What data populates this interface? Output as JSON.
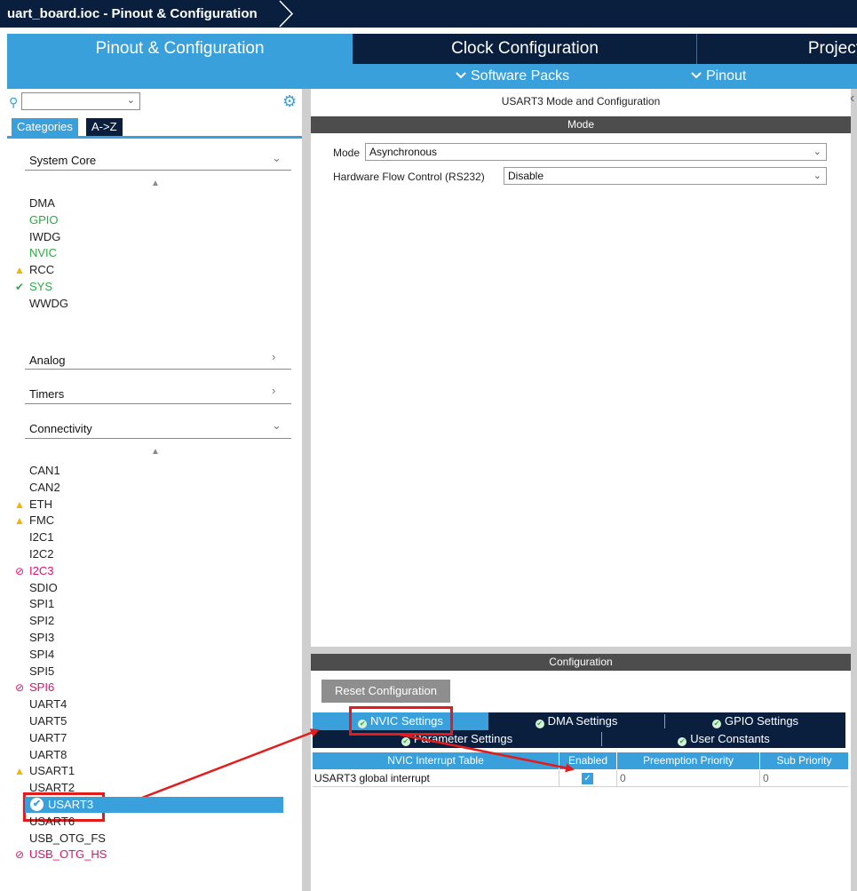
{
  "window": {
    "title": "uart_board.ioc - Pinout & Configuration"
  },
  "main_tabs": [
    "Pinout & Configuration",
    "Clock Configuration",
    "Project"
  ],
  "sub_tabs": [
    "Software Packs",
    "Pinout"
  ],
  "left_panel": {
    "category_tabs": [
      "Categories",
      "A->Z"
    ],
    "sections": {
      "system_core": "System Core",
      "analog": "Analog",
      "timers": "Timers",
      "connectivity": "Connectivity"
    },
    "system_core_items": [
      {
        "label": "DMA",
        "status": "none"
      },
      {
        "label": "GPIO",
        "status": "green"
      },
      {
        "label": "IWDG",
        "status": "none"
      },
      {
        "label": "NVIC",
        "status": "green"
      },
      {
        "label": "RCC",
        "status": "warning"
      },
      {
        "label": "SYS",
        "status": "ok"
      },
      {
        "label": "WWDG",
        "status": "none"
      }
    ],
    "connectivity_items": [
      {
        "label": "CAN1",
        "status": "none"
      },
      {
        "label": "CAN2",
        "status": "none"
      },
      {
        "label": "ETH",
        "status": "warning"
      },
      {
        "label": "FMC",
        "status": "warning"
      },
      {
        "label": "I2C1",
        "status": "none"
      },
      {
        "label": "I2C2",
        "status": "none"
      },
      {
        "label": "I2C3",
        "status": "disabled"
      },
      {
        "label": "SDIO",
        "status": "none"
      },
      {
        "label": "SPI1",
        "status": "none"
      },
      {
        "label": "SPI2",
        "status": "none"
      },
      {
        "label": "SPI3",
        "status": "none"
      },
      {
        "label": "SPI4",
        "status": "none"
      },
      {
        "label": "SPI5",
        "status": "none"
      },
      {
        "label": "SPI6",
        "status": "disabled"
      },
      {
        "label": "UART4",
        "status": "none"
      },
      {
        "label": "UART5",
        "status": "none"
      },
      {
        "label": "UART7",
        "status": "none"
      },
      {
        "label": "UART8",
        "status": "none"
      },
      {
        "label": "USART1",
        "status": "warning"
      },
      {
        "label": "USART2",
        "status": "none"
      },
      {
        "label": "USART3",
        "status": "selected"
      },
      {
        "label": "USART6",
        "status": "none"
      },
      {
        "label": "USB_OTG_FS",
        "status": "none"
      },
      {
        "label": "USB_OTG_HS",
        "status": "disabled"
      }
    ]
  },
  "right_panel": {
    "title": "USART3 Mode and Configuration",
    "mode_header": "Mode",
    "mode": {
      "label": "Mode",
      "value": "Asynchronous"
    },
    "flow_control": {
      "label": "Hardware Flow Control (RS232)",
      "value": "Disable"
    },
    "config_header": "Configuration",
    "reset_button": "Reset Configuration",
    "config_tabs_row1": [
      "NVIC Settings",
      "DMA Settings",
      "GPIO Settings"
    ],
    "config_tabs_row2": [
      "Parameter Settings",
      "User Constants"
    ],
    "table": {
      "headers": [
        "NVIC Interrupt Table",
        "Enabled",
        "Preemption Priority",
        "Sub Priority"
      ],
      "rows": [
        {
          "name": "USART3 global interrupt",
          "enabled": true,
          "preemption": "0",
          "sub": "0"
        }
      ]
    }
  },
  "colors": {
    "dark_navy": "#0a1f3d",
    "accent_blue": "#3aa0dc",
    "annotation_red": "#e41b1b",
    "ok_green": "#2eaa46",
    "warning_yellow": "#f4b400",
    "disabled_magenta": "#e0126e"
  }
}
